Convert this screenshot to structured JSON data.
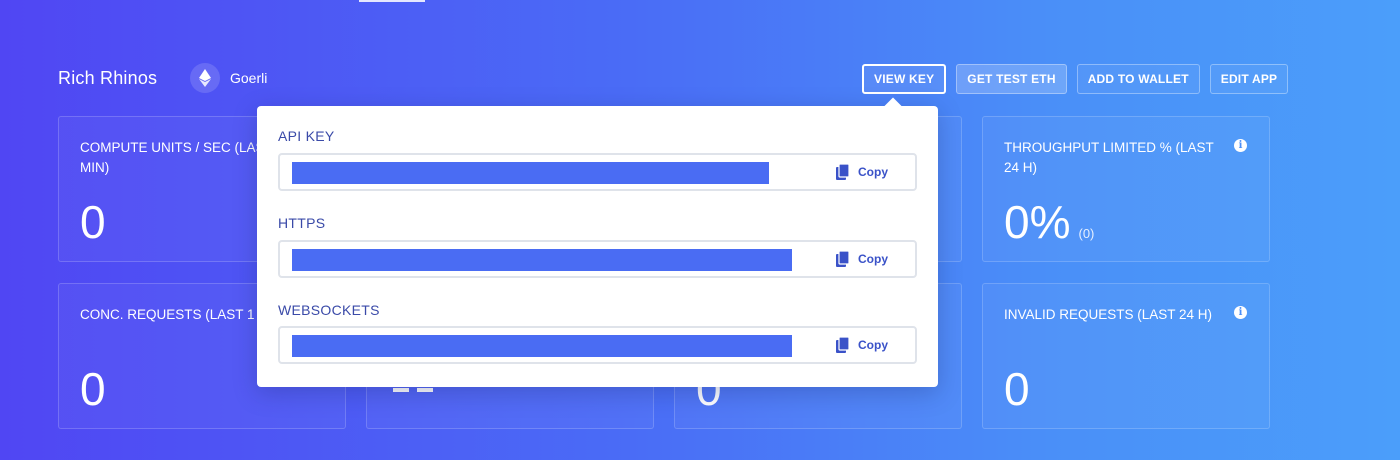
{
  "header": {
    "app_name": "Rich Rhinos",
    "network": "Goerli",
    "network_icon": "ethereum-icon"
  },
  "actions": {
    "view_key": "VIEW KEY",
    "get_test_eth": "GET TEST ETH",
    "add_to_wallet": "ADD TO WALLET",
    "edit_app": "EDIT APP"
  },
  "cards": {
    "compute_units": {
      "label": "COMPUTE UNITS / SEC (LAST 5 MIN)",
      "value": "0"
    },
    "throughput_limited": {
      "label": "THROUGHPUT LIMITED % (LAST 24 H)",
      "value": "0%",
      "sub": "(0)"
    },
    "conc_requests": {
      "label": "CONC. REQUESTS (LAST 1 H)",
      "value": "0"
    },
    "middle_card_2": {
      "value": "0"
    },
    "invalid_requests": {
      "label": "INVALID REQUESTS (LAST 24 H)",
      "value": "0"
    }
  },
  "key_popover": {
    "api_key": {
      "label": "API KEY",
      "copy": "Copy"
    },
    "https": {
      "label": "HTTPS",
      "copy": "Copy"
    },
    "websockets": {
      "label": "WEBSOCKETS",
      "copy": "Copy"
    }
  },
  "colors": {
    "gradient_start": "#5046f3",
    "gradient_end": "#4b9efa",
    "redaction": "#4a6cf3",
    "popover_label": "#3a4aa8"
  }
}
